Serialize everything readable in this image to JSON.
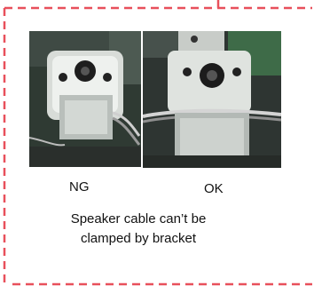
{
  "photos": {
    "ng": {
      "label": "NG"
    },
    "ok": {
      "label": "OK"
    }
  },
  "note": {
    "line1": "Speaker cable can’t be",
    "line2": "clamped by bracket"
  },
  "colors": {
    "dashed_border": "#e8505b",
    "text": "#111111",
    "background": "#ffffff"
  }
}
